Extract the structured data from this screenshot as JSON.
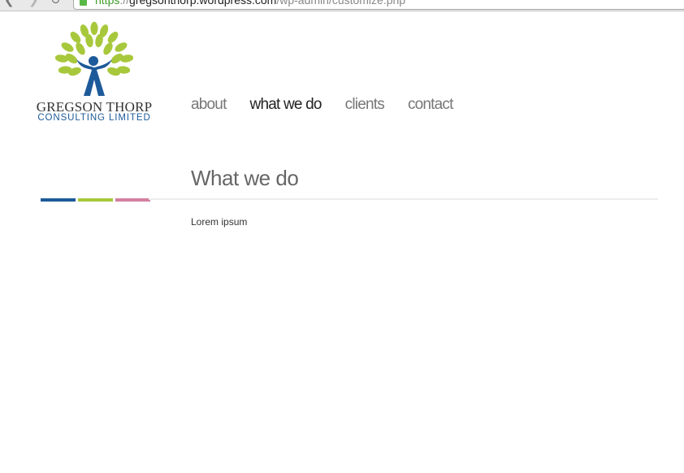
{
  "browser": {
    "url_scheme": "https",
    "url_sep": "://",
    "url_host": "gregsonthorp.wordpress.com",
    "url_path": "/wp-admin/customize.php"
  },
  "logo": {
    "name": "GREGSON THORP",
    "subtitle": "CONSULTING LIMITED",
    "leaf_color": "#a8c83c",
    "figure_color": "#1d5a99"
  },
  "nav": {
    "items": [
      {
        "label": "about"
      },
      {
        "label": "what we do"
      },
      {
        "label": "clients"
      },
      {
        "label": "contact"
      }
    ],
    "active_index": 1
  },
  "page": {
    "title": "What we do",
    "body": "Lorem ipsum"
  },
  "accent_colors": [
    "#1d5a99",
    "#a8c83c",
    "#d37fa0"
  ]
}
